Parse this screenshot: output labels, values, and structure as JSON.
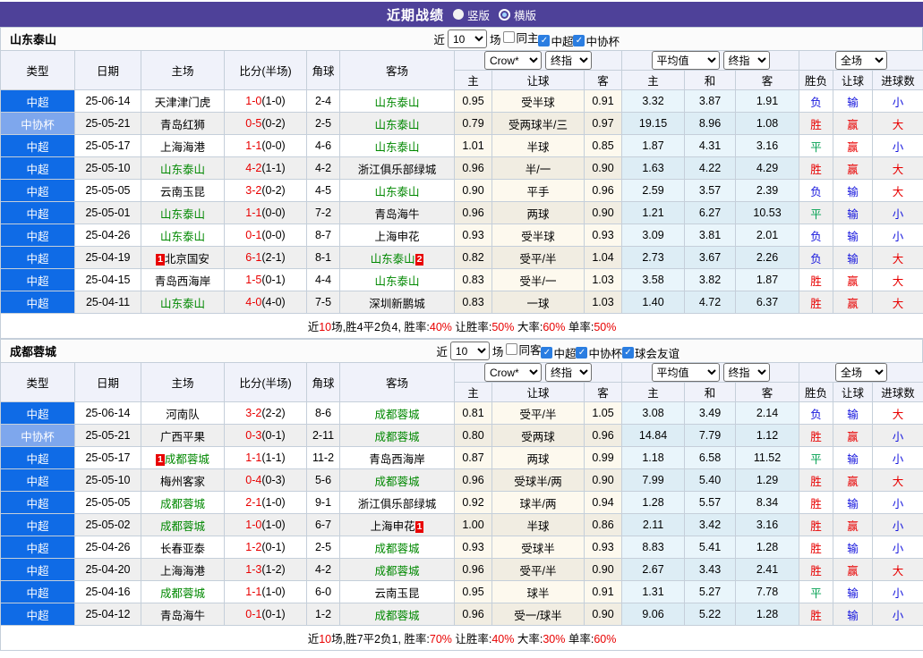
{
  "titlebar": {
    "title": "近期战绩",
    "radios": [
      {
        "label": "竖版",
        "checked": false
      },
      {
        "label": "横版",
        "checked": true
      }
    ]
  },
  "colors": {
    "titlebar_purple": "#4e4199",
    "league_csl_blue": "#0f6be6",
    "league_cup_blue": "#7ea7ed",
    "team_highlight_green": "#008800",
    "win_red": "#e80000",
    "draw_green": "#00a050",
    "lose_blue": "#1414dd",
    "badge_red": "#e80000"
  },
  "color_map": {
    "胜": "red",
    "平": "green",
    "负": "blue",
    "赢": "red",
    "输": "blue",
    "大": "red",
    "小": "blue"
  },
  "type_color_key": {
    "中超": "league_csl_blue",
    "中协杯": "league_cup_blue"
  },
  "header": {
    "type": "类型",
    "date": "日期",
    "home": "主场",
    "score": "比分(半场)",
    "corner": "角球",
    "away": "客场",
    "groups": {
      "crow": "Crow*",
      "crow_final": "终指",
      "avg": "平均值",
      "avg_final": "终指",
      "full": "全场"
    },
    "sub": {
      "h": "主",
      "handicap": "让球",
      "a": "客",
      "avg_h": "主",
      "avg_d": "和",
      "avg_a": "客",
      "result": "胜负",
      "let_result": "让球",
      "goals": "进球数"
    }
  },
  "sections": [
    {
      "team": "山东泰山",
      "filters": {
        "prefix": "近",
        "select": "10",
        "suffix": "场",
        "checks": [
          {
            "label": "同主",
            "checked": false
          },
          {
            "label": "中超",
            "checked": true
          },
          {
            "label": "中协杯",
            "checked": true
          }
        ]
      },
      "rows": [
        {
          "type": "中超",
          "date": "25-06-14",
          "home": {
            "t": "天津津门虎"
          },
          "ft": "1-0",
          "ht": "(1-0)",
          "corner": "2-4",
          "away": {
            "t": "山东泰山",
            "g": 1
          },
          "o1": "0.95",
          "hc": "受半球",
          "o2": "0.91",
          "a1": "3.32",
          "a2": "3.87",
          "a3": "1.91",
          "r1": "负",
          "r2": "输",
          "r3": "小"
        },
        {
          "type": "中协杯",
          "date": "25-05-21",
          "home": {
            "t": "青岛红狮"
          },
          "ft": "0-5",
          "ht": "(0-2)",
          "corner": "2-5",
          "away": {
            "t": "山东泰山",
            "g": 1
          },
          "o1": "0.79",
          "hc": "受两球半/三",
          "o2": "0.97",
          "a1": "19.15",
          "a2": "8.96",
          "a3": "1.08",
          "r1": "胜",
          "r2": "赢",
          "r3": "大"
        },
        {
          "type": "中超",
          "date": "25-05-17",
          "home": {
            "t": "上海海港"
          },
          "ft": "1-1",
          "ht": "(0-0)",
          "corner": "4-6",
          "away": {
            "t": "山东泰山",
            "g": 1
          },
          "o1": "1.01",
          "hc": "半球",
          "o2": "0.85",
          "a1": "1.87",
          "a2": "4.31",
          "a3": "3.16",
          "r1": "平",
          "r2": "赢",
          "r3": "小"
        },
        {
          "type": "中超",
          "date": "25-05-10",
          "home": {
            "t": "山东泰山",
            "g": 1
          },
          "ft": "4-2",
          "ht": "(1-1)",
          "corner": "4-2",
          "away": {
            "t": "浙江俱乐部绿城"
          },
          "o1": "0.96",
          "hc": "半/一",
          "o2": "0.90",
          "a1": "1.63",
          "a2": "4.22",
          "a3": "4.29",
          "r1": "胜",
          "r2": "赢",
          "r3": "大"
        },
        {
          "type": "中超",
          "date": "25-05-05",
          "home": {
            "t": "云南玉昆"
          },
          "ft": "3-2",
          "ht": "(0-2)",
          "corner": "4-5",
          "away": {
            "t": "山东泰山",
            "g": 1
          },
          "o1": "0.90",
          "hc": "平手",
          "o2": "0.96",
          "a1": "2.59",
          "a2": "3.57",
          "a3": "2.39",
          "r1": "负",
          "r2": "输",
          "r3": "大"
        },
        {
          "type": "中超",
          "date": "25-05-01",
          "home": {
            "t": "山东泰山",
            "g": 1
          },
          "ft": "1-1",
          "ht": "(0-0)",
          "corner": "7-2",
          "away": {
            "t": "青岛海牛"
          },
          "o1": "0.96",
          "hc": "两球",
          "o2": "0.90",
          "a1": "1.21",
          "a2": "6.27",
          "a3": "10.53",
          "r1": "平",
          "r2": "输",
          "r3": "小"
        },
        {
          "type": "中超",
          "date": "25-04-26",
          "home": {
            "t": "山东泰山",
            "g": 1
          },
          "ft": "0-1",
          "ht": "(0-0)",
          "corner": "8-7",
          "away": {
            "t": "上海申花"
          },
          "o1": "0.93",
          "hc": "受半球",
          "o2": "0.93",
          "a1": "3.09",
          "a2": "3.81",
          "a3": "2.01",
          "r1": "负",
          "r2": "输",
          "r3": "小"
        },
        {
          "type": "中超",
          "date": "25-04-19",
          "home": {
            "t": "北京国安",
            "b1": "1"
          },
          "ft": "6-1",
          "ht": "(2-1)",
          "corner": "8-1",
          "away": {
            "t": "山东泰山",
            "g": 1,
            "b2": "2"
          },
          "o1": "0.82",
          "hc": "受平/半",
          "o2": "1.04",
          "a1": "2.73",
          "a2": "3.67",
          "a3": "2.26",
          "r1": "负",
          "r2": "输",
          "r3": "大"
        },
        {
          "type": "中超",
          "date": "25-04-15",
          "home": {
            "t": "青岛西海岸"
          },
          "ft": "1-5",
          "ht": "(0-1)",
          "corner": "4-4",
          "away": {
            "t": "山东泰山",
            "g": 1
          },
          "o1": "0.83",
          "hc": "受半/一",
          "o2": "1.03",
          "a1": "3.58",
          "a2": "3.82",
          "a3": "1.87",
          "r1": "胜",
          "r2": "赢",
          "r3": "大"
        },
        {
          "type": "中超",
          "date": "25-04-11",
          "home": {
            "t": "山东泰山",
            "g": 1
          },
          "ft": "4-0",
          "ht": "(4-0)",
          "corner": "7-5",
          "away": {
            "t": "深圳新鹏城"
          },
          "o1": "0.83",
          "hc": "一球",
          "o2": "1.03",
          "a1": "1.40",
          "a2": "4.72",
          "a3": "6.37",
          "r1": "胜",
          "r2": "赢",
          "r3": "大"
        }
      ],
      "summary": [
        {
          "t": "近"
        },
        {
          "t": "10",
          "r": 1
        },
        {
          "t": "场,胜4平2负4, 胜率:"
        },
        {
          "t": "40%",
          "r": 1
        },
        {
          "t": " 让胜率:"
        },
        {
          "t": "50%",
          "r": 1
        },
        {
          "t": " 大率:"
        },
        {
          "t": "60%",
          "r": 1
        },
        {
          "t": " 单率:"
        },
        {
          "t": "50%",
          "r": 1
        }
      ]
    },
    {
      "team": "成都蓉城",
      "filters": {
        "prefix": "近",
        "select": "10",
        "suffix": "场",
        "checks": [
          {
            "label": "同客",
            "checked": false
          },
          {
            "label": "中超",
            "checked": true
          },
          {
            "label": "中协杯",
            "checked": true
          },
          {
            "label": "球会友谊",
            "checked": true
          }
        ]
      },
      "rows": [
        {
          "type": "中超",
          "date": "25-06-14",
          "home": {
            "t": "河南队"
          },
          "ft": "3-2",
          "ht": "(2-2)",
          "corner": "8-6",
          "away": {
            "t": "成都蓉城",
            "g": 1
          },
          "o1": "0.81",
          "hc": "受平/半",
          "o2": "1.05",
          "a1": "3.08",
          "a2": "3.49",
          "a3": "2.14",
          "r1": "负",
          "r2": "输",
          "r3": "大"
        },
        {
          "type": "中协杯",
          "date": "25-05-21",
          "home": {
            "t": "广西平果"
          },
          "ft": "0-3",
          "ht": "(0-1)",
          "corner": "2-11",
          "away": {
            "t": "成都蓉城",
            "g": 1
          },
          "o1": "0.80",
          "hc": "受两球",
          "o2": "0.96",
          "a1": "14.84",
          "a2": "7.79",
          "a3": "1.12",
          "r1": "胜",
          "r2": "赢",
          "r3": "小"
        },
        {
          "type": "中超",
          "date": "25-05-17",
          "home": {
            "t": "成都蓉城",
            "g": 1,
            "b1": "1"
          },
          "ft": "1-1",
          "ht": "(1-1)",
          "corner": "11-2",
          "away": {
            "t": "青岛西海岸"
          },
          "o1": "0.87",
          "hc": "两球",
          "o2": "0.99",
          "a1": "1.18",
          "a2": "6.58",
          "a3": "11.52",
          "r1": "平",
          "r2": "输",
          "r3": "小"
        },
        {
          "type": "中超",
          "date": "25-05-10",
          "home": {
            "t": "梅州客家"
          },
          "ft": "0-4",
          "ht": "(0-3)",
          "corner": "5-6",
          "away": {
            "t": "成都蓉城",
            "g": 1
          },
          "o1": "0.96",
          "hc": "受球半/两",
          "o2": "0.90",
          "a1": "7.99",
          "a2": "5.40",
          "a3": "1.29",
          "r1": "胜",
          "r2": "赢",
          "r3": "大"
        },
        {
          "type": "中超",
          "date": "25-05-05",
          "home": {
            "t": "成都蓉城",
            "g": 1
          },
          "ft": "2-1",
          "ht": "(1-0)",
          "corner": "9-1",
          "away": {
            "t": "浙江俱乐部绿城"
          },
          "o1": "0.92",
          "hc": "球半/两",
          "o2": "0.94",
          "a1": "1.28",
          "a2": "5.57",
          "a3": "8.34",
          "r1": "胜",
          "r2": "输",
          "r3": "小"
        },
        {
          "type": "中超",
          "date": "25-05-02",
          "home": {
            "t": "成都蓉城",
            "g": 1
          },
          "ft": "1-0",
          "ht": "(1-0)",
          "corner": "6-7",
          "away": {
            "t": "上海申花",
            "b2": "1"
          },
          "o1": "1.00",
          "hc": "半球",
          "o2": "0.86",
          "a1": "2.11",
          "a2": "3.42",
          "a3": "3.16",
          "r1": "胜",
          "r2": "赢",
          "r3": "小"
        },
        {
          "type": "中超",
          "date": "25-04-26",
          "home": {
            "t": "长春亚泰"
          },
          "ft": "1-2",
          "ht": "(0-1)",
          "corner": "2-5",
          "away": {
            "t": "成都蓉城",
            "g": 1
          },
          "o1": "0.93",
          "hc": "受球半",
          "o2": "0.93",
          "a1": "8.83",
          "a2": "5.41",
          "a3": "1.28",
          "r1": "胜",
          "r2": "输",
          "r3": "小"
        },
        {
          "type": "中超",
          "date": "25-04-20",
          "home": {
            "t": "上海海港"
          },
          "ft": "1-3",
          "ht": "(1-2)",
          "corner": "4-2",
          "away": {
            "t": "成都蓉城",
            "g": 1
          },
          "o1": "0.96",
          "hc": "受平/半",
          "o2": "0.90",
          "a1": "2.67",
          "a2": "3.43",
          "a3": "2.41",
          "r1": "胜",
          "r2": "赢",
          "r3": "大"
        },
        {
          "type": "中超",
          "date": "25-04-16",
          "home": {
            "t": "成都蓉城",
            "g": 1
          },
          "ft": "1-1",
          "ht": "(1-0)",
          "corner": "6-0",
          "away": {
            "t": "云南玉昆"
          },
          "o1": "0.95",
          "hc": "球半",
          "o2": "0.91",
          "a1": "1.31",
          "a2": "5.27",
          "a3": "7.78",
          "r1": "平",
          "r2": "输",
          "r3": "小"
        },
        {
          "type": "中超",
          "date": "25-04-12",
          "home": {
            "t": "青岛海牛"
          },
          "ft": "0-1",
          "ht": "(0-1)",
          "corner": "1-2",
          "away": {
            "t": "成都蓉城",
            "g": 1
          },
          "o1": "0.96",
          "hc": "受一/球半",
          "o2": "0.90",
          "a1": "9.06",
          "a2": "5.22",
          "a3": "1.28",
          "r1": "胜",
          "r2": "输",
          "r3": "小"
        }
      ],
      "summary": [
        {
          "t": "近"
        },
        {
          "t": "10",
          "r": 1
        },
        {
          "t": "场,胜7平2负1, 胜率:"
        },
        {
          "t": "70%",
          "r": 1
        },
        {
          "t": " 让胜率:"
        },
        {
          "t": "40%",
          "r": 1
        },
        {
          "t": " 大率:"
        },
        {
          "t": "30%",
          "r": 1
        },
        {
          "t": " 单率:"
        },
        {
          "t": "60%",
          "r": 1
        }
      ]
    }
  ]
}
